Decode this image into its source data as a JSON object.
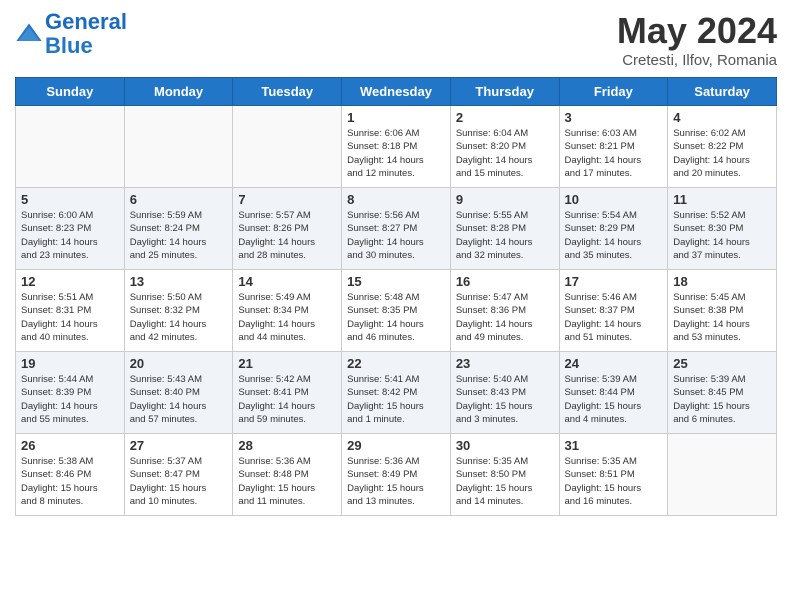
{
  "header": {
    "logo_line1": "General",
    "logo_line2": "Blue",
    "main_title": "May 2024",
    "subtitle": "Cretesti, Ilfov, Romania"
  },
  "calendar": {
    "days_of_week": [
      "Sunday",
      "Monday",
      "Tuesday",
      "Wednesday",
      "Thursday",
      "Friday",
      "Saturday"
    ],
    "weeks": [
      [
        {
          "day": "",
          "info": ""
        },
        {
          "day": "",
          "info": ""
        },
        {
          "day": "",
          "info": ""
        },
        {
          "day": "1",
          "info": "Sunrise: 6:06 AM\nSunset: 8:18 PM\nDaylight: 14 hours\nand 12 minutes."
        },
        {
          "day": "2",
          "info": "Sunrise: 6:04 AM\nSunset: 8:20 PM\nDaylight: 14 hours\nand 15 minutes."
        },
        {
          "day": "3",
          "info": "Sunrise: 6:03 AM\nSunset: 8:21 PM\nDaylight: 14 hours\nand 17 minutes."
        },
        {
          "day": "4",
          "info": "Sunrise: 6:02 AM\nSunset: 8:22 PM\nDaylight: 14 hours\nand 20 minutes."
        }
      ],
      [
        {
          "day": "5",
          "info": "Sunrise: 6:00 AM\nSunset: 8:23 PM\nDaylight: 14 hours\nand 23 minutes."
        },
        {
          "day": "6",
          "info": "Sunrise: 5:59 AM\nSunset: 8:24 PM\nDaylight: 14 hours\nand 25 minutes."
        },
        {
          "day": "7",
          "info": "Sunrise: 5:57 AM\nSunset: 8:26 PM\nDaylight: 14 hours\nand 28 minutes."
        },
        {
          "day": "8",
          "info": "Sunrise: 5:56 AM\nSunset: 8:27 PM\nDaylight: 14 hours\nand 30 minutes."
        },
        {
          "day": "9",
          "info": "Sunrise: 5:55 AM\nSunset: 8:28 PM\nDaylight: 14 hours\nand 32 minutes."
        },
        {
          "day": "10",
          "info": "Sunrise: 5:54 AM\nSunset: 8:29 PM\nDaylight: 14 hours\nand 35 minutes."
        },
        {
          "day": "11",
          "info": "Sunrise: 5:52 AM\nSunset: 8:30 PM\nDaylight: 14 hours\nand 37 minutes."
        }
      ],
      [
        {
          "day": "12",
          "info": "Sunrise: 5:51 AM\nSunset: 8:31 PM\nDaylight: 14 hours\nand 40 minutes."
        },
        {
          "day": "13",
          "info": "Sunrise: 5:50 AM\nSunset: 8:32 PM\nDaylight: 14 hours\nand 42 minutes."
        },
        {
          "day": "14",
          "info": "Sunrise: 5:49 AM\nSunset: 8:34 PM\nDaylight: 14 hours\nand 44 minutes."
        },
        {
          "day": "15",
          "info": "Sunrise: 5:48 AM\nSunset: 8:35 PM\nDaylight: 14 hours\nand 46 minutes."
        },
        {
          "day": "16",
          "info": "Sunrise: 5:47 AM\nSunset: 8:36 PM\nDaylight: 14 hours\nand 49 minutes."
        },
        {
          "day": "17",
          "info": "Sunrise: 5:46 AM\nSunset: 8:37 PM\nDaylight: 14 hours\nand 51 minutes."
        },
        {
          "day": "18",
          "info": "Sunrise: 5:45 AM\nSunset: 8:38 PM\nDaylight: 14 hours\nand 53 minutes."
        }
      ],
      [
        {
          "day": "19",
          "info": "Sunrise: 5:44 AM\nSunset: 8:39 PM\nDaylight: 14 hours\nand 55 minutes."
        },
        {
          "day": "20",
          "info": "Sunrise: 5:43 AM\nSunset: 8:40 PM\nDaylight: 14 hours\nand 57 minutes."
        },
        {
          "day": "21",
          "info": "Sunrise: 5:42 AM\nSunset: 8:41 PM\nDaylight: 14 hours\nand 59 minutes."
        },
        {
          "day": "22",
          "info": "Sunrise: 5:41 AM\nSunset: 8:42 PM\nDaylight: 15 hours\nand 1 minute."
        },
        {
          "day": "23",
          "info": "Sunrise: 5:40 AM\nSunset: 8:43 PM\nDaylight: 15 hours\nand 3 minutes."
        },
        {
          "day": "24",
          "info": "Sunrise: 5:39 AM\nSunset: 8:44 PM\nDaylight: 15 hours\nand 4 minutes."
        },
        {
          "day": "25",
          "info": "Sunrise: 5:39 AM\nSunset: 8:45 PM\nDaylight: 15 hours\nand 6 minutes."
        }
      ],
      [
        {
          "day": "26",
          "info": "Sunrise: 5:38 AM\nSunset: 8:46 PM\nDaylight: 15 hours\nand 8 minutes."
        },
        {
          "day": "27",
          "info": "Sunrise: 5:37 AM\nSunset: 8:47 PM\nDaylight: 15 hours\nand 10 minutes."
        },
        {
          "day": "28",
          "info": "Sunrise: 5:36 AM\nSunset: 8:48 PM\nDaylight: 15 hours\nand 11 minutes."
        },
        {
          "day": "29",
          "info": "Sunrise: 5:36 AM\nSunset: 8:49 PM\nDaylight: 15 hours\nand 13 minutes."
        },
        {
          "day": "30",
          "info": "Sunrise: 5:35 AM\nSunset: 8:50 PM\nDaylight: 15 hours\nand 14 minutes."
        },
        {
          "day": "31",
          "info": "Sunrise: 5:35 AM\nSunset: 8:51 PM\nDaylight: 15 hours\nand 16 minutes."
        },
        {
          "day": "",
          "info": ""
        }
      ]
    ]
  }
}
